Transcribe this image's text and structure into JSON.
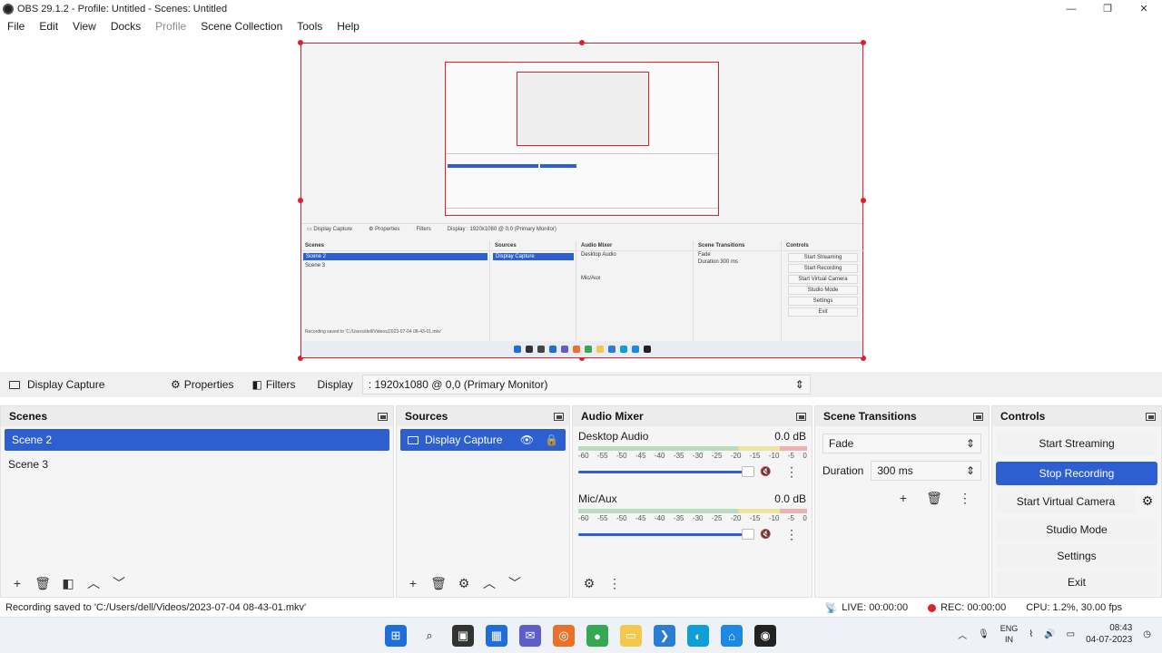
{
  "window": {
    "title": "OBS 29.1.2 - Profile: Untitled - Scenes: Untitled",
    "minimize": "—",
    "maximize": "❐",
    "close": "✕"
  },
  "menu": {
    "items": [
      "File",
      "Edit",
      "View",
      "Docks",
      "Profile",
      "Scene Collection",
      "Tools",
      "Help"
    ]
  },
  "source_toolbar": {
    "source_name": "Display Capture",
    "properties_label": "Properties",
    "filters_label": "Filters",
    "display_label": "Display",
    "display_value": ": 1920x1080 @ 0,0 (Primary Monitor)"
  },
  "scenes": {
    "title": "Scenes",
    "items": [
      "Scene 2",
      "Scene 3"
    ],
    "selected_index": 0
  },
  "sources": {
    "title": "Sources",
    "items": [
      "Display Capture"
    ]
  },
  "audio_mixer": {
    "title": "Audio Mixer",
    "channels": [
      {
        "name": "Desktop Audio",
        "db": "0.0 dB",
        "fader_level": 1.0
      },
      {
        "name": "Mic/Aux",
        "db": "0.0 dB",
        "fader_level": 1.0
      }
    ],
    "ticks": [
      "-60",
      "-55",
      "-50",
      "-45",
      "-40",
      "-35",
      "-30",
      "-25",
      "-20",
      "-15",
      "-10",
      "-5",
      "0"
    ]
  },
  "scene_transitions": {
    "title": "Scene Transitions",
    "transition": "Fade",
    "duration_label": "Duration",
    "duration_value": "300 ms"
  },
  "controls": {
    "title": "Controls",
    "start_streaming": "Start Streaming",
    "stop_recording": "Stop Recording",
    "start_virtual_camera": "Start Virtual Camera",
    "studio_mode": "Studio Mode",
    "settings": "Settings",
    "exit": "Exit"
  },
  "status": {
    "message": "Recording saved to 'C:/Users/dell/Videos/2023-07-04 08-43-01.mkv'",
    "live": "LIVE: 00:00:00",
    "rec": "REC: 00:00:00",
    "cpu": "CPU: 1.2%, 30.00 fps"
  },
  "tray": {
    "lang_top": "ENG",
    "lang_bottom": "IN",
    "time": "08:43",
    "date": "04-07-2023"
  },
  "colors": {
    "accent": "#2e5fd0",
    "selection_red": "#e01f2d"
  }
}
